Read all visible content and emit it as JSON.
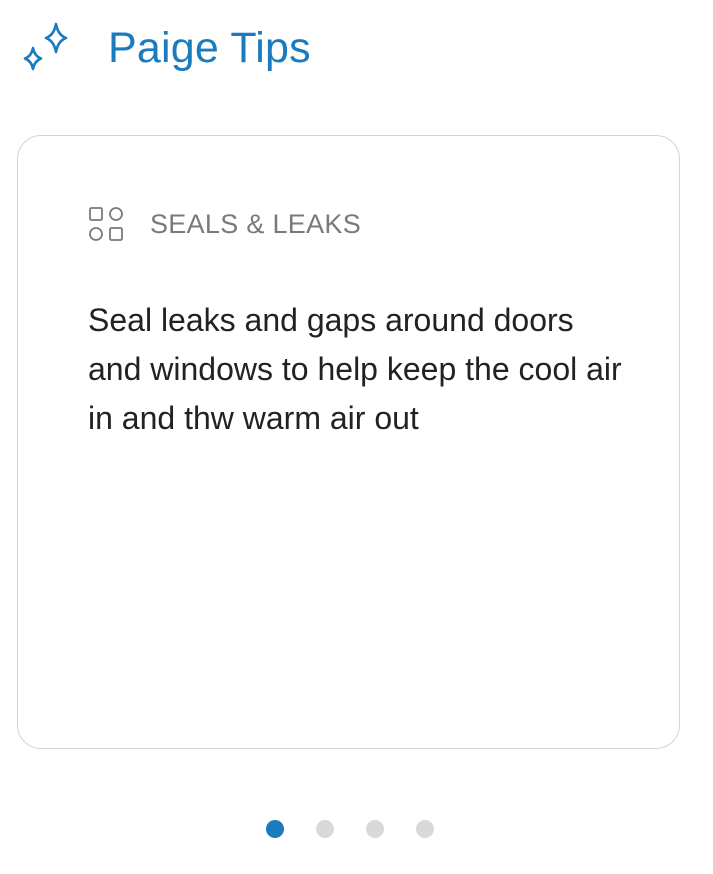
{
  "header": {
    "icon": "sparkle-icon",
    "title": "Paige Tips"
  },
  "tip": {
    "category_icon": "categories-grid-icon",
    "category": "SEALS & LEAKS",
    "text": "Seal leaks and gaps around doors and windows to help keep the cool air in and thw warm air out"
  },
  "pagination": {
    "total": 4,
    "active_index": 0
  },
  "colors": {
    "accent": "#1a7bbf",
    "inactive_dot": "#d9d9d9",
    "card_border": "#d4d4d4",
    "category_text": "#7a7a7a",
    "body_text": "#222222"
  }
}
